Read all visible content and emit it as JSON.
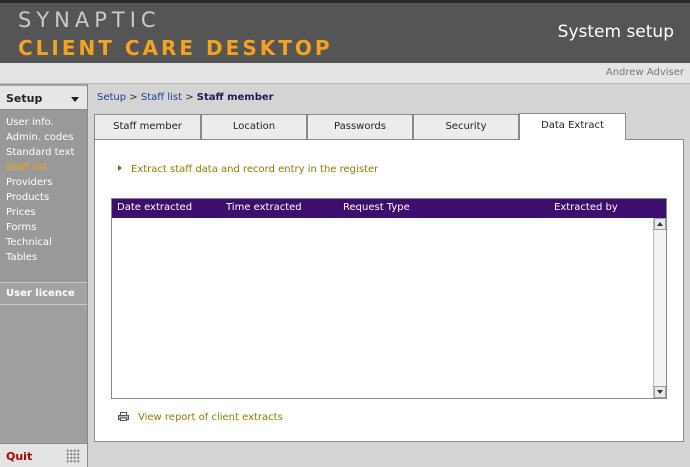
{
  "header": {
    "brand_line1": "SYNAPTIC",
    "brand_line2": "CLIENT CARE DESKTOP",
    "title": "System setup",
    "accent_color": "#f4a31a"
  },
  "user": {
    "name": "Andrew Adviser"
  },
  "sidebar": {
    "section_label": "Setup",
    "items": [
      {
        "label": "User info."
      },
      {
        "label": "Admin. codes"
      },
      {
        "label": "Standard text"
      },
      {
        "label": "Staff list"
      },
      {
        "label": "Providers"
      },
      {
        "label": "Products"
      },
      {
        "label": "Prices"
      },
      {
        "label": "Forms"
      },
      {
        "label": "Technical"
      },
      {
        "label": "Tables"
      }
    ],
    "active_item": "Staff list",
    "licence_label": "User licence",
    "quit_label": "Quit"
  },
  "breadcrumb": {
    "level1": "Setup",
    "level2": "Staff list",
    "current": "Staff member",
    "separator": ">"
  },
  "tabs": [
    {
      "label": "Staff member"
    },
    {
      "label": "Location"
    },
    {
      "label": "Passwords"
    },
    {
      "label": "Security"
    },
    {
      "label": "Data Extract"
    }
  ],
  "active_tab": "Data Extract",
  "extract_action": {
    "label": "Extract staff data and record entry in the register"
  },
  "table": {
    "columns": [
      "Date extracted",
      "Time extracted",
      "Request Type",
      "Extracted by"
    ],
    "rows": [],
    "header_color": "#3d0e6e"
  },
  "report_link": {
    "label": "View report of client extracts",
    "icon": "printer-icon"
  }
}
